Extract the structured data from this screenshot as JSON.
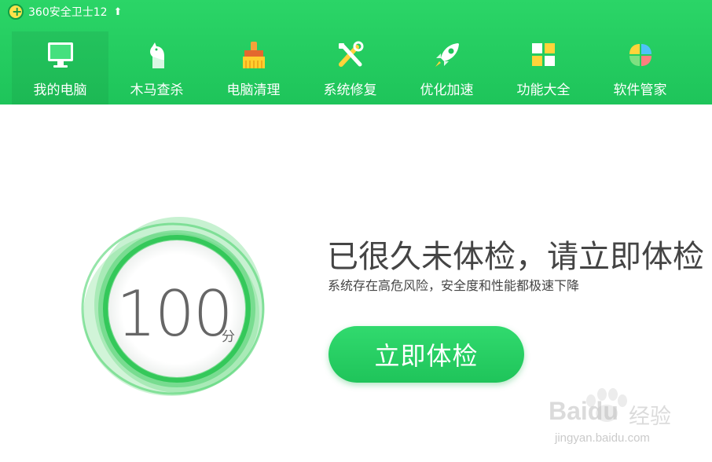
{
  "app": {
    "title": "360安全卫士12",
    "update_icon": "up-arrow-icon"
  },
  "nav": {
    "items": [
      {
        "label": "我的电脑",
        "icon": "monitor-icon",
        "active": true
      },
      {
        "label": "木马查杀",
        "icon": "horse-icon",
        "active": false
      },
      {
        "label": "电脑清理",
        "icon": "broom-icon",
        "active": false
      },
      {
        "label": "系统修复",
        "icon": "tools-icon",
        "active": false
      },
      {
        "label": "优化加速",
        "icon": "rocket-icon",
        "active": false
      },
      {
        "label": "功能大全",
        "icon": "grid-icon",
        "active": false
      },
      {
        "label": "软件管家",
        "icon": "flower-icon",
        "active": false
      }
    ]
  },
  "main": {
    "score": "100",
    "score_unit": "分",
    "headline": "已很久未体检，请立即体检",
    "subline": "系统存在高危风险，安全度和性能都极速下降",
    "check_button": "立即体检"
  },
  "watermark": {
    "brand": "Baidu",
    "brand_cn": "经验",
    "url": "jingyan.baidu.com"
  },
  "colors": {
    "brand_green": "#1ec45a",
    "text_dark": "#444444"
  }
}
